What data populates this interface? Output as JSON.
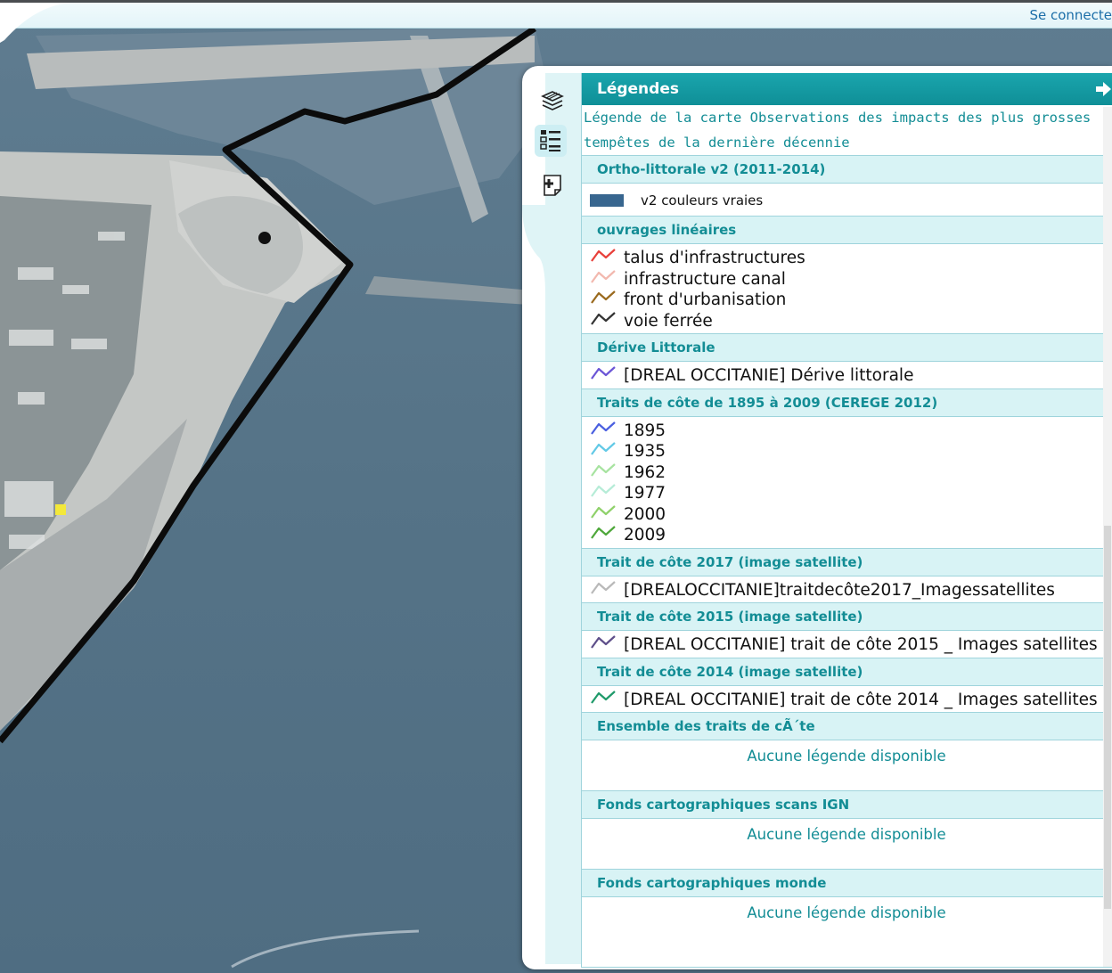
{
  "topbar": {
    "login_label": "Se connecte"
  },
  "toolbar": {
    "layers_icon": "layers-icon",
    "legend_icon": "legend-icon",
    "add_icon": "add-layer-icon"
  },
  "legend": {
    "header": "Légendes",
    "title": "Légende de la carte Observations des impacts des plus grosses tempêtes de la dernière décennie",
    "groups": [
      {
        "name": "Ortho-littorale v2 (2011-2014)",
        "items": [
          {
            "label": "v2 couleurs vraies",
            "color": "#38668f"
          }
        ]
      },
      {
        "name": "ouvrages linéaires",
        "items": [
          {
            "label": "talus d'infrastructures",
            "color": "#e8403a"
          },
          {
            "label": "infrastructure canal",
            "color": "#f2b8ae"
          },
          {
            "label": "front d'urbanisation",
            "color": "#9a6a1e"
          },
          {
            "label": "voie ferrée",
            "color": "#333333"
          }
        ]
      },
      {
        "name": "Dérive Littorale",
        "items": [
          {
            "label": "[DREAL OCCITANIE] Dérive littorale",
            "color": "#6b55d6"
          }
        ]
      },
      {
        "name": "Traits de côte de 1895 à 2009 (CEREGE 2012)",
        "items": [
          {
            "label": "1895",
            "color": "#4a5fe0"
          },
          {
            "label": "1935",
            "color": "#62c9e6"
          },
          {
            "label": "1962",
            "color": "#a7e3a0"
          },
          {
            "label": "1977",
            "color": "#b6ecd7"
          },
          {
            "label": "2000",
            "color": "#8fd16a"
          },
          {
            "label": "2009",
            "color": "#4ea73a"
          }
        ]
      },
      {
        "name": "Trait de côte 2017 (image satellite)",
        "items": [
          {
            "label": "[DREALOCCITANIE]traitdecôte2017_Imagessatellites",
            "color": "#b9b9b9"
          }
        ]
      },
      {
        "name": "Trait de côte 2015 (image satellite)",
        "items": [
          {
            "label": "[DREAL OCCITANIE] trait de côte 2015 _ Images satellites",
            "color": "#5e4f8a"
          }
        ]
      },
      {
        "name": "Trait de côte 2014 (image satellite)",
        "items": [
          {
            "label": "[DREAL OCCITANIE] trait de côte 2014 _ Images satellites",
            "color": "#1f9a6a"
          }
        ]
      },
      {
        "name": "Ensemble des traits de cÃ´te",
        "empty": "Aucune légende disponible"
      },
      {
        "name": "Fonds cartographiques scans IGN",
        "empty": "Aucune légende disponible"
      },
      {
        "name": "Fonds cartographiques monde",
        "empty": "Aucune légende disponible"
      }
    ]
  }
}
